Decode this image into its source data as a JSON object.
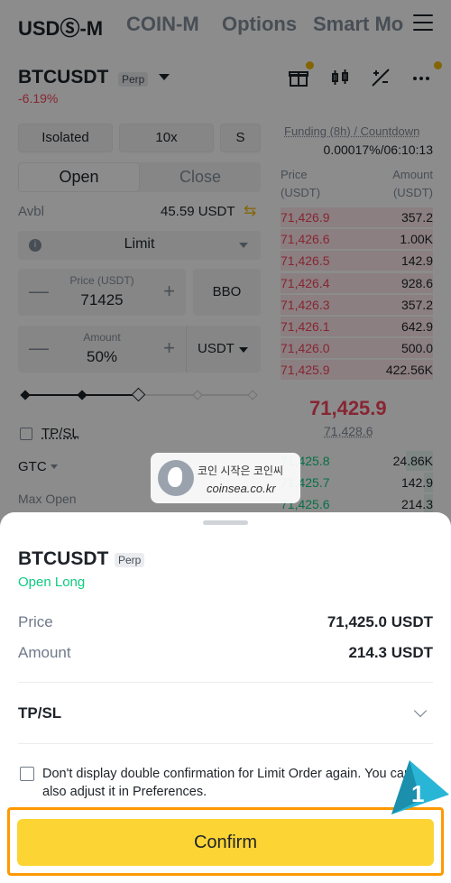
{
  "topnav": {
    "tabs": [
      "USDⓈ-M",
      "COIN-M",
      "Options",
      "Smart Mo"
    ]
  },
  "header": {
    "symbol": "BTCUSDT",
    "tag": "Perp",
    "change": "-6.19%"
  },
  "controls": {
    "margin_mode": "Isolated",
    "leverage": "10x",
    "asset_mode": "S",
    "open_tab": "Open",
    "close_tab": "Close",
    "avbl_label": "Avbl",
    "avbl_value": "45.59 USDT",
    "order_type": "Limit",
    "price_caption": "Price (USDT)",
    "price_value": "71425",
    "bbo": "BBO",
    "amount_caption": "Amount",
    "amount_value": "50%",
    "amount_unit": "USDT",
    "amount_slider_fraction": 0.5,
    "tpsl": "TP/SL",
    "tif": "GTC",
    "max_open": "Max Open"
  },
  "orderbook": {
    "funding_label": "Funding (8h) / Countdown",
    "funding_value": "0.00017%/06:10:13",
    "col_price": "Price\n(USDT)",
    "col_amount": "Amount\n(USDT)",
    "asks": [
      {
        "price": "71,426.9",
        "amount": "357.2"
      },
      {
        "price": "71,426.6",
        "amount": "1.00K"
      },
      {
        "price": "71,426.5",
        "amount": "142.9"
      },
      {
        "price": "71,426.4",
        "amount": "928.6"
      },
      {
        "price": "71,426.3",
        "amount": "357.2"
      },
      {
        "price": "71,426.1",
        "amount": "642.9"
      },
      {
        "price": "71,426.0",
        "amount": "500.0"
      },
      {
        "price": "71,425.9",
        "amount": "422.56K"
      }
    ],
    "mid_price": "71,425.9",
    "mark_price": "71,428.6",
    "bids": [
      {
        "price": "71,425.8",
        "amount": "24.86K"
      },
      {
        "price": "71,425.7",
        "amount": "142.9"
      },
      {
        "price": "71,425.6",
        "amount": "214.3"
      }
    ]
  },
  "watermark": {
    "line1": "코인 시작은 코인씨",
    "line2": "coinsea.co.kr"
  },
  "sheet": {
    "symbol": "BTCUSDT",
    "tag": "Perp",
    "side": "Open Long",
    "price_label": "Price",
    "price_value": "71,425.0 USDT",
    "amount_label": "Amount",
    "amount_value": "214.3 USDT",
    "tpsl_label": "TP/SL",
    "checkbox_label": "Don't display double confirmation for Limit Order again. You can also adjust it in Preferences.",
    "confirm_label": "Confirm"
  },
  "annotation": {
    "step": "1"
  },
  "colors": {
    "accent": "#fcd535",
    "green": "#0ecb81",
    "red": "#f6465d",
    "highlight": "#ff9900",
    "step_marker": "#29b6d6"
  }
}
